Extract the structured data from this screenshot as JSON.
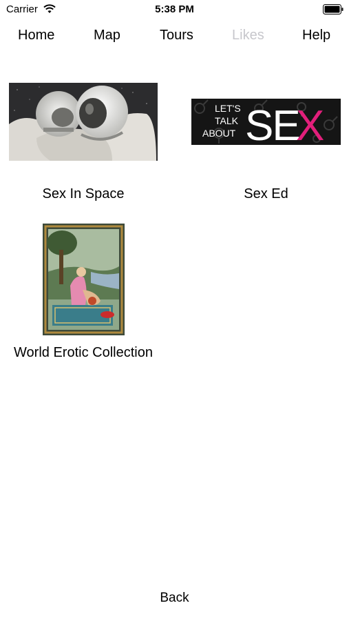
{
  "status_bar": {
    "carrier": "Carrier",
    "time": "5:38 PM"
  },
  "nav": {
    "items": [
      {
        "label": "Home"
      },
      {
        "label": "Map"
      },
      {
        "label": "Tours"
      },
      {
        "label": "Likes"
      },
      {
        "label": "Help"
      }
    ]
  },
  "tiles": [
    {
      "label": "Sex In Space"
    },
    {
      "label": "Sex Ed",
      "image_text": {
        "line1": "LET'S",
        "line2": "TALK",
        "line3": "ABOUT",
        "big": "SE",
        "big_x": "X"
      }
    },
    {
      "label": "World Erotic Collection"
    }
  ],
  "footer": {
    "back_label": "Back"
  },
  "colors": {
    "dim_tab": "#c7c7cc",
    "sexed_bg": "#151515",
    "sexed_accent": "#e21f7b"
  }
}
